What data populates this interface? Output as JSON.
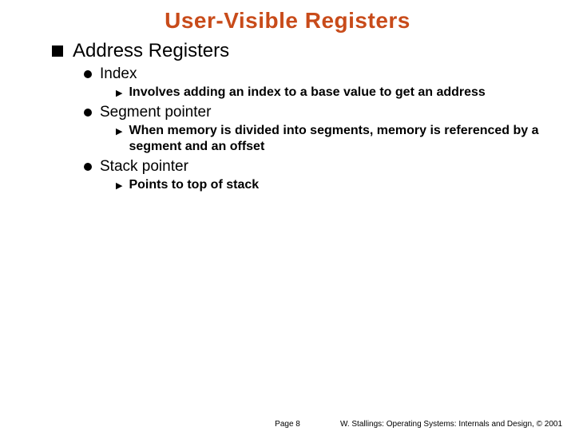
{
  "title": "User-Visible Registers",
  "h1": "Address Registers",
  "items": [
    {
      "label": "Index",
      "desc": "Involves adding an index to a base value to get an address"
    },
    {
      "label": "Segment pointer",
      "desc": "When memory is divided into segments, memory is referenced by a segment and an offset"
    },
    {
      "label": "Stack pointer",
      "desc": "Points to top of stack"
    }
  ],
  "footer": {
    "page": "Page 8",
    "credit": "W. Stallings: Operating Systems: Internals and Design, © 2001"
  }
}
